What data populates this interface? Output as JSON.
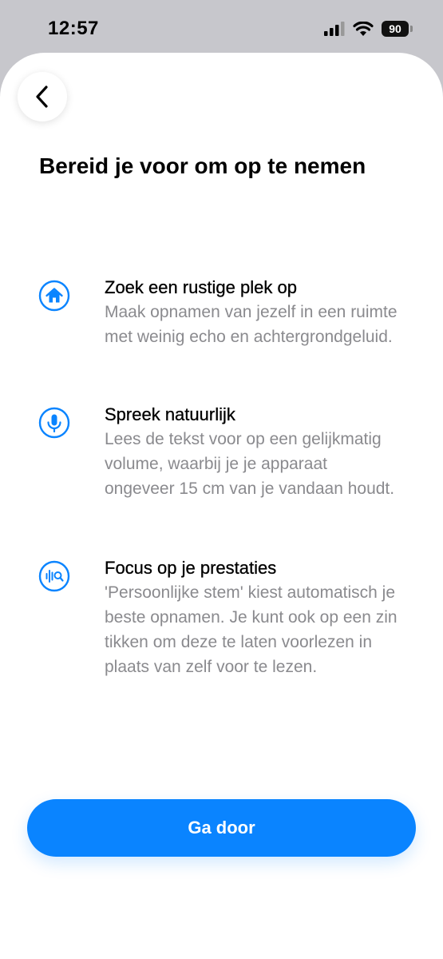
{
  "status_bar": {
    "time": "12:57",
    "battery": "90"
  },
  "nav": {
    "back_icon": "chevron-left-icon"
  },
  "page": {
    "title": "Bereid je voor om op te nemen"
  },
  "items": [
    {
      "icon": "house-icon",
      "title": "Zoek een rustige plek op",
      "description": "Maak opnamen van jezelf in een ruimte met weinig echo en achtergrondgeluid."
    },
    {
      "icon": "microphone-icon",
      "title": "Spreek natuurlijk",
      "description": "Lees de tekst voor op een gelijkmatig volume, waarbij je je apparaat ongeveer 15 cm van je vandaan houdt."
    },
    {
      "icon": "waveform-search-icon",
      "title": "Focus op je prestaties",
      "description": "'Persoonlijke stem' kiest automatisch je beste opnamen. Je kunt ook op een zin tikken om deze te laten voorlezen in plaats van zelf voor te lezen."
    }
  ],
  "actions": {
    "continue_label": "Ga door"
  },
  "colors": {
    "accent": "#0a84ff",
    "secondary_text": "#8a8a8e"
  }
}
